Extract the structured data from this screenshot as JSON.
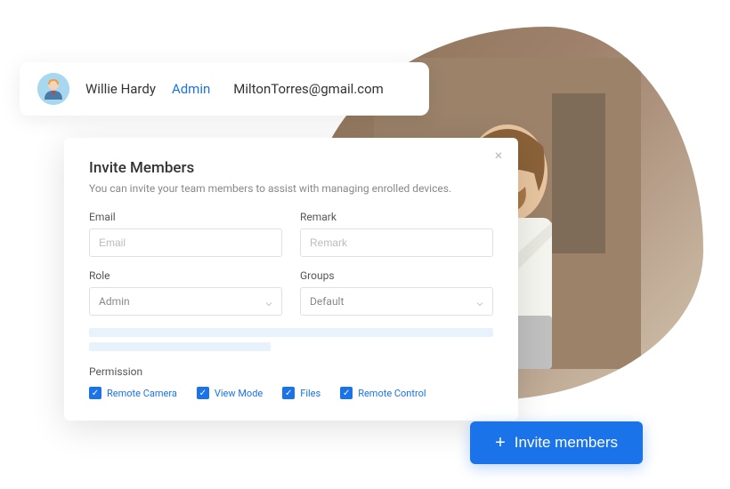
{
  "user_card": {
    "name": "Willie Hardy",
    "role": "Admin",
    "email": "MiltonTorres@gmail.com"
  },
  "modal": {
    "title": "Invite Members",
    "subtitle": "You can invite your team members to assist with managing enrolled devices.",
    "fields": {
      "email": {
        "label": "Email",
        "placeholder": "Email",
        "value": ""
      },
      "remark": {
        "label": "Remark",
        "placeholder": "Remark",
        "value": ""
      },
      "role": {
        "label": "Role",
        "selected": "Admin"
      },
      "groups": {
        "label": "Groups",
        "selected": "Default"
      }
    },
    "permission_label": "Permission",
    "permissions": [
      {
        "label": "Remote Camera",
        "checked": true
      },
      {
        "label": "View Mode",
        "checked": true
      },
      {
        "label": "Files",
        "checked": true
      },
      {
        "label": "Remote Control",
        "checked": true
      }
    ]
  },
  "invite_button": {
    "label": "Invite members"
  },
  "colors": {
    "primary": "#1a73e8",
    "text": "#333",
    "muted": "#888"
  }
}
